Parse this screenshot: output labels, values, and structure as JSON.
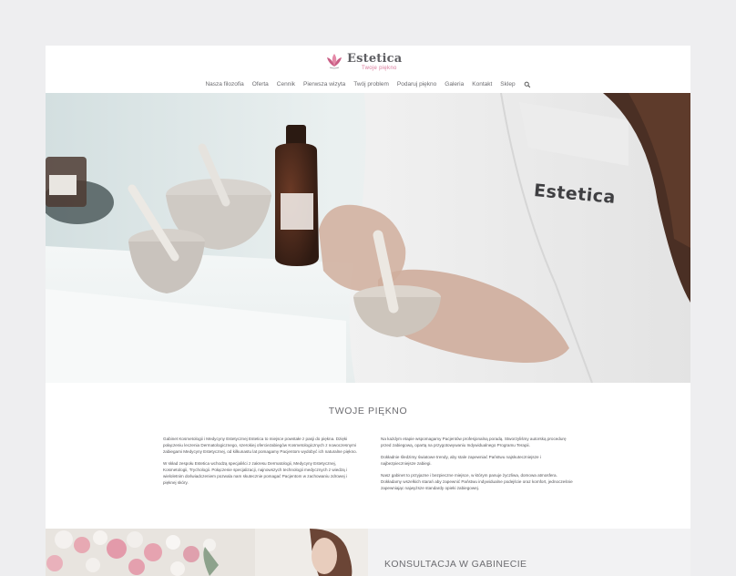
{
  "header": {
    "logo_name": "Estetica",
    "logo_tagline": "Twoje piękno",
    "brand_color": "#d9789a"
  },
  "nav": {
    "items": [
      "Nasza filozofia",
      "Oferta",
      "Cennik",
      "Pierwsza wizyta",
      "Twój problem",
      "Podaruj piękno",
      "Galeria",
      "Kontakt",
      "Sklep"
    ],
    "search_icon": "search-icon"
  },
  "hero": {
    "coat_label": "Estetica"
  },
  "section": {
    "title": "TWOJE PIĘKNO",
    "left_paragraphs": [
      "Gabinet Kosmetologii i Medycyny Estetycznej Estetica to miejsce powstałe z pasji do piękna. Dzięki połączeniu leczenia Dermatologicznego, szerokiej oferciezabiegów Kosmetologicznych z nowoczesnymi zabiegami Medycyny Estetycznej, od kilkunastu lat pomagamy Pacjentom wydobyć ich naturalne piękno.",
      "W skład zespołu Estetica wchodzą specjaliści z zakresu Dermatologii, Medycyny Estetycznej, Kosmetologii, Trychologii. Połączenie specjalizacji, najnowszych technologii medycznych z wiedzą i wieloletnim doświadczeniem pozwala nam skutecznie pomagać Pacjentom w zachowaniu zdrowej i pięknej skóry."
    ],
    "right_paragraphs": [
      "Na każdym etapie wspomagamy Pacjentów profesjonalną poradą. Stworzyliśmy autorską procedurę przed zabiegową, opartą na przygotowywaniu Indywidualnego Programu Terapii.",
      "Dokładnie śledzimy światowe trendy, aby stale zapewniać Państwu najskuteczniejsze i najbezpieczniejsze zabiegi.",
      "Nasz gabinet to przyjazne i bezpieczne miejsce, w którym panuje życzliwa, domowa atmosfera. Dokładamy wszelkich starań aby zapewnić Państwu indywidualne podejście oraz komfort, jednocześnie zapewniając najwyższe standardy opieki zabiegowej."
    ]
  },
  "bottom": {
    "title": "KONSULTACJA W GABINECIE"
  }
}
